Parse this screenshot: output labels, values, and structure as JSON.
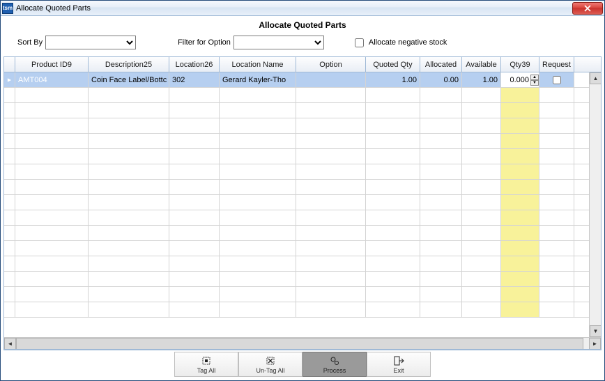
{
  "window": {
    "app_icon_text": "tsm",
    "title": "Allocate Quoted Parts"
  },
  "header": {
    "title": "Allocate Quoted Parts",
    "sort_by_label": "Sort By",
    "sort_by_value": "",
    "filter_label": "Filter for Option",
    "filter_value": "",
    "neg_stock_label": "Allocate negative stock",
    "neg_stock_checked": false
  },
  "grid": {
    "columns": {
      "product_id": "Product ID9",
      "description": "Description25",
      "location": "Location26",
      "location_name": "Location Name",
      "option": "Option",
      "quoted_qty": "Quoted Qty",
      "allocated": "Allocated",
      "available": "Available",
      "qty": "Qty39",
      "request": "Request"
    },
    "rows": [
      {
        "product_id": "AMT004",
        "description": "Coin Face Label/Bottc",
        "location": "302",
        "location_name": "Gerard Kayler-Tho",
        "option": "",
        "quoted_qty": "1.00",
        "allocated": "0.00",
        "available": "1.00",
        "qty": "0.000",
        "request_checked": false
      }
    ],
    "blank_row_count": 15
  },
  "toolbar": {
    "tag_all": "Tag All",
    "untag_all": "Un-Tag All",
    "process": "Process",
    "exit": "Exit"
  }
}
